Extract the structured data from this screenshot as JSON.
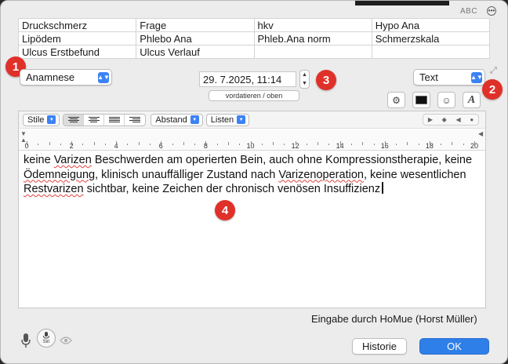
{
  "window": {
    "abc_label": "ABC",
    "more_icon": "ellipsis-circle-icon"
  },
  "keyword_table": {
    "rows": [
      [
        "Druckschmerz",
        "Frage",
        "hkv",
        "Hypo Ana"
      ],
      [
        "Lipödem",
        "Phlebo Ana",
        "Phleb.Ana norm",
        "Schmerzskala"
      ],
      [
        "Ulcus Erstbefund",
        "Ulcus Verlauf",
        "",
        ""
      ]
    ]
  },
  "badges": [
    "1",
    "2",
    "3",
    "4"
  ],
  "category_select": {
    "value": "Anamnese"
  },
  "date_field": {
    "value": "29.  7.2025, 11:14"
  },
  "predate_button": {
    "label": "vordatieren / oben"
  },
  "type_select": {
    "value": "Text"
  },
  "format_buttons": [
    "gear-icon",
    "color-swatch-icon",
    "smiley-icon",
    "font-icon"
  ],
  "editor": {
    "toolbar": {
      "styles_label": "Stile",
      "spacing_label": "Abstand",
      "lists_label": "Listen"
    },
    "ruler": {
      "numbers": [
        "0",
        "2",
        "4",
        "6",
        "8",
        "10",
        "12",
        "14",
        "16",
        "18",
        "20"
      ]
    },
    "text": {
      "p1": "keine ",
      "w1": "Varizen",
      "p2": " Beschwerden am operierten Bein, auch ohne Kompressionstherapie, keine ",
      "w2": "Ödemneigung",
      "p3": ", klinisch unauffälliger Zustand nach ",
      "w3": "Varizenoperation",
      "p4": ", keine wesentlichen ",
      "w4": "Restvarizen",
      "p5": " sichtbar, keine Zeichen der chronisch venösen Insuffizienz"
    }
  },
  "author_line": "Eingabe durch HoMue (Horst Müller)",
  "buttons": {
    "history": "Historie",
    "ok": "OK"
  },
  "siri_label": "Siri",
  "colors": {
    "badge": "#e0302a",
    "accent": "#2f7fe8",
    "spellcheck": "#e34040"
  }
}
